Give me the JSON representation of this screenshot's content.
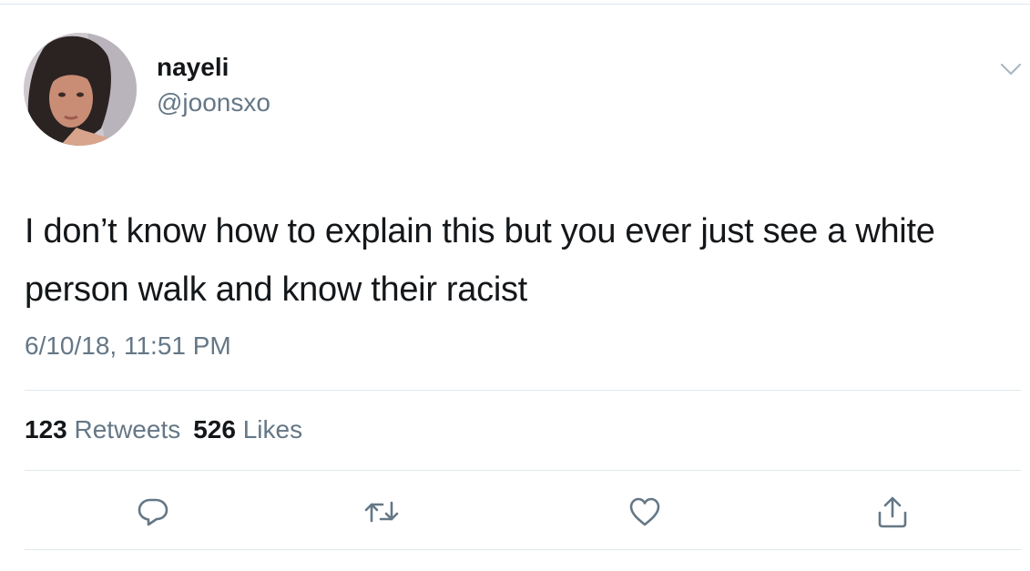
{
  "user": {
    "display_name": "nayeli",
    "handle": "@joonsxo"
  },
  "tweet": {
    "text": "I don’t know how to explain this but you ever just see a white person walk and know their racist",
    "timestamp": "6/10/18, 11:51 PM"
  },
  "stats": {
    "retweets_count": "123",
    "retweets_label": "Retweets",
    "likes_count": "526",
    "likes_label": "Likes"
  },
  "icons": {
    "more": "chevron-down-icon",
    "reply": "reply-icon",
    "retweet": "retweet-icon",
    "like": "heart-icon",
    "share": "share-icon"
  },
  "colors": {
    "text_primary": "#14171a",
    "text_secondary": "#657786",
    "divider": "#e1e8ed",
    "icon": "#657786"
  }
}
